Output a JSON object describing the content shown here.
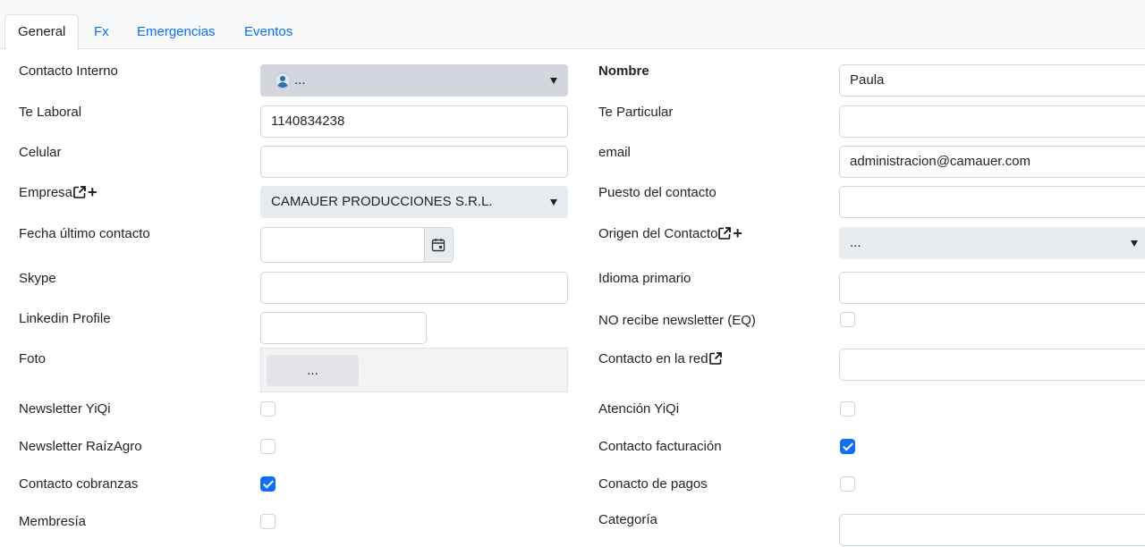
{
  "tabs": [
    {
      "label": "General",
      "active": true
    },
    {
      "label": "Fx",
      "active": false
    },
    {
      "label": "Emergencias",
      "active": false
    },
    {
      "label": "Eventos",
      "active": false
    }
  ],
  "left": {
    "contacto_interno": {
      "label": "Contacto Interno",
      "value": "..."
    },
    "te_laboral": {
      "label": "Te Laboral",
      "value": "1140834238"
    },
    "celular": {
      "label": "Celular",
      "value": ""
    },
    "empresa": {
      "label": "Empresa",
      "value": "CAMAUER PRODUCCIONES S.R.L."
    },
    "fecha_ultimo_contacto": {
      "label": "Fecha último contacto",
      "value": ""
    },
    "skype": {
      "label": "Skype",
      "value": ""
    },
    "linkedin": {
      "label": "Linkedin Profile",
      "value": ""
    },
    "foto": {
      "label": "Foto",
      "button": "..."
    },
    "newsletter_yiqi": {
      "label": "Newsletter YiQi",
      "checked": false
    },
    "newsletter_raizagro": {
      "label": "Newsletter RaízAgro",
      "checked": false
    },
    "contacto_cobranzas": {
      "label": "Contacto cobranzas",
      "checked": true
    },
    "membresia": {
      "label": "Membresía",
      "checked": false
    }
  },
  "right": {
    "nombre": {
      "label": "Nombre",
      "value": "Paula"
    },
    "te_particular": {
      "label": "Te Particular",
      "value": ""
    },
    "email": {
      "label": "email",
      "value": "administracion@camauer.com"
    },
    "puesto": {
      "label": "Puesto del contacto",
      "value": ""
    },
    "origen": {
      "label": "Origen del Contacto",
      "value": "..."
    },
    "idioma": {
      "label": "Idioma primario",
      "value": ""
    },
    "no_newsletter": {
      "label": "NO recibe newsletter (EQ)",
      "checked": false
    },
    "contacto_red": {
      "label": "Contacto en la red",
      "value": ""
    },
    "atencion_yiqi": {
      "label": "Atención YiQi",
      "checked": false
    },
    "contacto_facturacion": {
      "label": "Contacto facturación",
      "checked": true
    },
    "conacto_pagos": {
      "label": "Conacto de pagos",
      "checked": false
    },
    "categoria": {
      "label": "Categoría",
      "value": ""
    }
  },
  "colors": {
    "accent": "#0d6efd",
    "select_bg": "#d3d6dc",
    "tab_bg": "#f8f9fa"
  }
}
